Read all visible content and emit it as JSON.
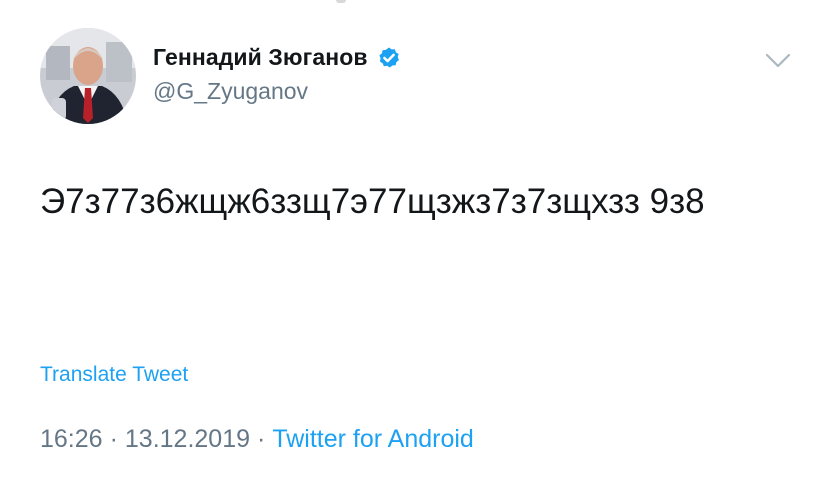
{
  "tweet": {
    "author": {
      "display_name": "Геннадий Зюганов",
      "handle": "@G_Zyuganov",
      "verified": true
    },
    "text": "Э7з77з6жщж6ззщ7э77щзжз7з7зщхзз 9з8",
    "translate_label": "Translate Tweet",
    "time": "16:26",
    "separator": "·",
    "date": "13.12.2019",
    "source": "Twitter for Android"
  },
  "icons": {
    "verified": "verified-badge-icon",
    "menu": "chevron-down-icon"
  },
  "colors": {
    "link": "#1da1f2",
    "secondary_text": "#657786",
    "primary_text": "#14171a",
    "chevron": "#aab8c2"
  }
}
